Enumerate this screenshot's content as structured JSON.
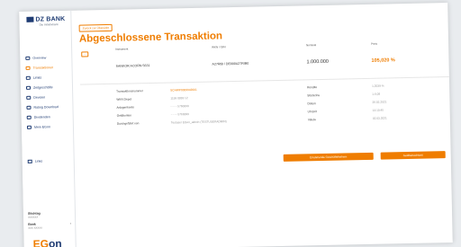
{
  "brand": {
    "name": "DZ BANK",
    "sub": "Die Initiativbank",
    "logo_word_a": "EG",
    "logo_word_b": "on"
  },
  "sidebar": {
    "items": [
      {
        "label": "Overview",
        "active": false,
        "icon": "overview-icon"
      },
      {
        "label": "Transaktionen",
        "active": true,
        "icon": "list-icon"
      },
      {
        "label": "Limits",
        "active": false,
        "icon": "limits-icon"
      },
      {
        "label": "Zeitgeschäfte",
        "active": false,
        "icon": "bar-chart-icon"
      },
      {
        "label": "Devisen",
        "active": false,
        "icon": "currency-icon"
      },
      {
        "label": "Rating Download",
        "active": false,
        "icon": "download-icon"
      },
      {
        "label": "Dividenden",
        "active": false,
        "icon": "document-icon"
      },
      {
        "label": "Mein EGon",
        "active": false,
        "icon": "user-icon"
      }
    ],
    "extra": {
      "label": "Links",
      "icon": "link-icon"
    },
    "user": {
      "name": "Stichtag",
      "sub": "XXXXXX",
      "bank_label": "Bank",
      "bank_sub": "XXX XXXXX"
    }
  },
  "main": {
    "back_label": "Zurück zur Übersicht",
    "title": "Abgeschlossene Transaktion",
    "headers": [
      "Instrument",
      "WKN / ISIN",
      "Nominal",
      "Preis"
    ],
    "values": [
      "SANKOR ACORN 5631",
      "A27RIB / DE000A27RIB0",
      "1.000.000",
      "105,020 %"
    ],
    "details_left": [
      {
        "label": "Transaktionsnummer",
        "value": "SCHWP0000042001",
        "highlight": true
      },
      {
        "label": "WKN Depot",
        "value": "1199 8833 12",
        "highlight": false
      },
      {
        "label": "Anlagenkonto",
        "value": "- - - - 5760000",
        "highlight": false
      },
      {
        "label": "Geldkonten",
        "value": "- - - - 5760000",
        "highlight": false
      },
      {
        "label": "Durchgeführt von",
        "value": "Testuser EGon_admin (TESTUSERADMIN)",
        "highlight": false
      }
    ],
    "details_right": [
      {
        "label": "Rendite",
        "value": "1,2039 %"
      },
      {
        "label": "Stückzins",
        "value": "1.6,08"
      },
      {
        "label": "Datum",
        "value": "26.02.2021"
      },
      {
        "label": "Uhrzeit",
        "value": "14:10:45"
      },
      {
        "label": "Valuta",
        "value": "02.03.2021"
      }
    ],
    "buttons": {
      "primary": "Einstehende Geschäftsfreihern",
      "secondary": "Geldbetrachtzeit"
    }
  }
}
